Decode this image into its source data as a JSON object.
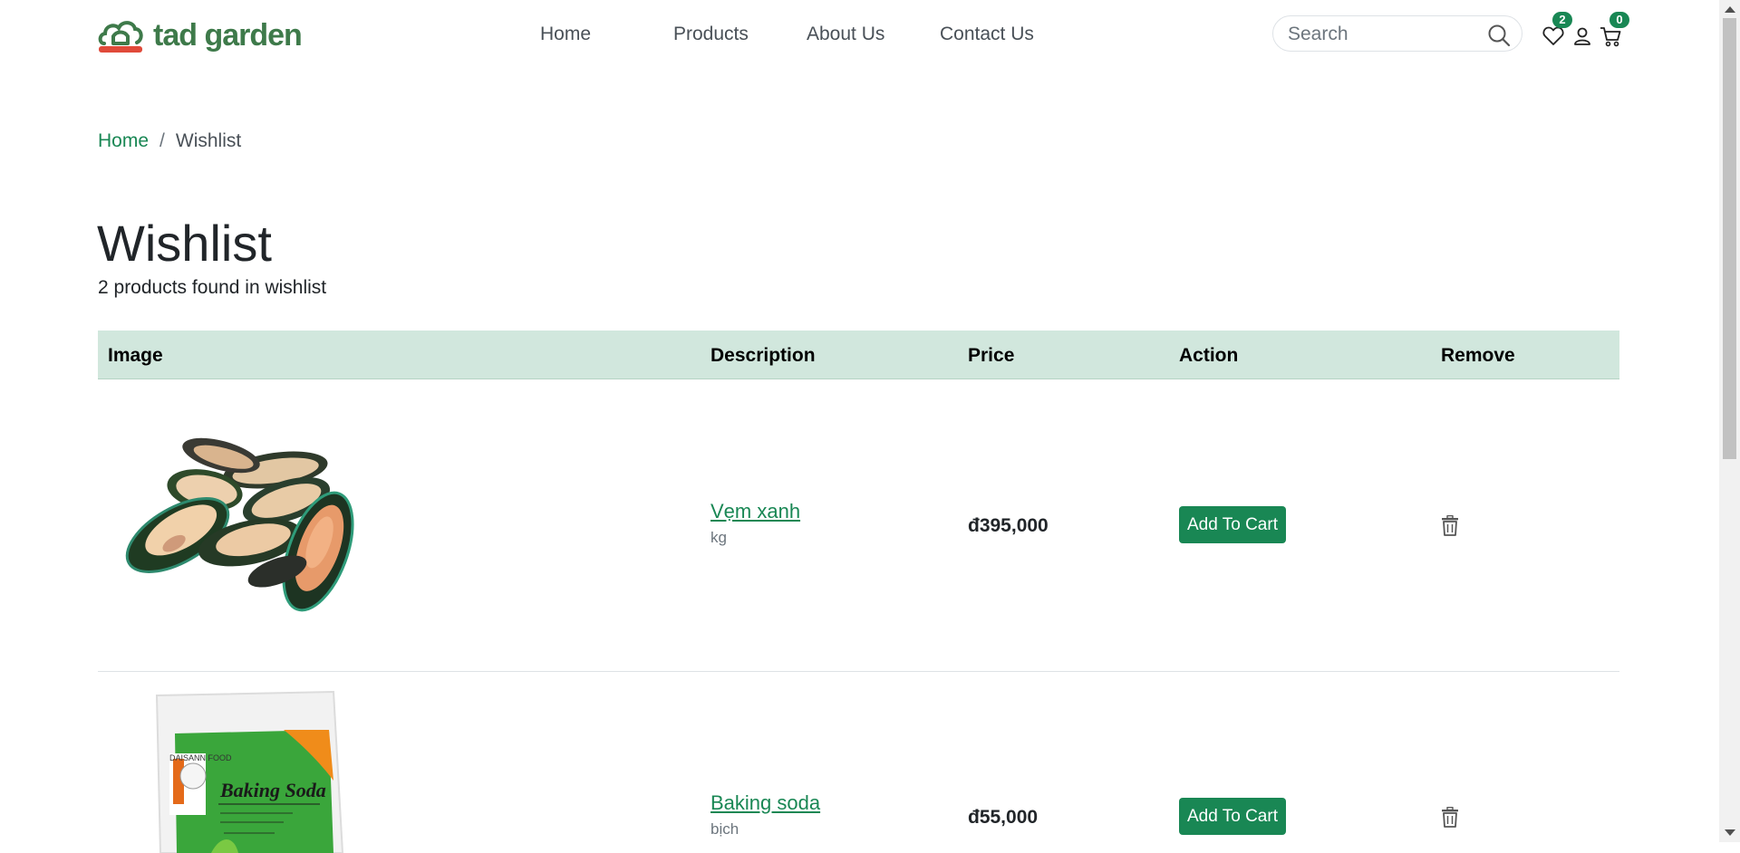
{
  "brand": {
    "name": "tad garden",
    "primary_color": "#198754",
    "logo_color": "#3e7a4a",
    "logo_accent": "#e04a3a"
  },
  "nav": {
    "items": [
      {
        "label": "Home"
      },
      {
        "label": "Products"
      },
      {
        "label": "About Us"
      },
      {
        "label": "Contact Us"
      }
    ]
  },
  "search": {
    "placeholder": "Search",
    "value": ""
  },
  "header_icons": {
    "wishlist_icon": "heart-icon",
    "account_icon": "user-icon",
    "cart_icon": "cart-icon",
    "wishlist_count": "2",
    "cart_count": "0"
  },
  "breadcrumb": {
    "home": "Home",
    "separator": "/",
    "current": "Wishlist"
  },
  "page": {
    "title": "Wishlist",
    "subtitle": "2 products found in wishlist"
  },
  "table": {
    "headers": {
      "image": "Image",
      "description": "Description",
      "price": "Price",
      "action": "Action",
      "remove": "Remove"
    },
    "header_bg": "#d1e7dd",
    "rows": [
      {
        "name": "Vẹm xanh",
        "unit": "kg",
        "price": "đ395,000",
        "action_label": "Add To Cart",
        "remove_icon": "trash-icon"
      },
      {
        "name": "Baking soda",
        "unit": "bịch",
        "price": "đ55,000",
        "action_label": "Add To Cart",
        "remove_icon": "trash-icon"
      }
    ]
  },
  "product_image_text": {
    "package_title": "Baking Soda",
    "brand_mark": "DAISANN FOOD"
  }
}
